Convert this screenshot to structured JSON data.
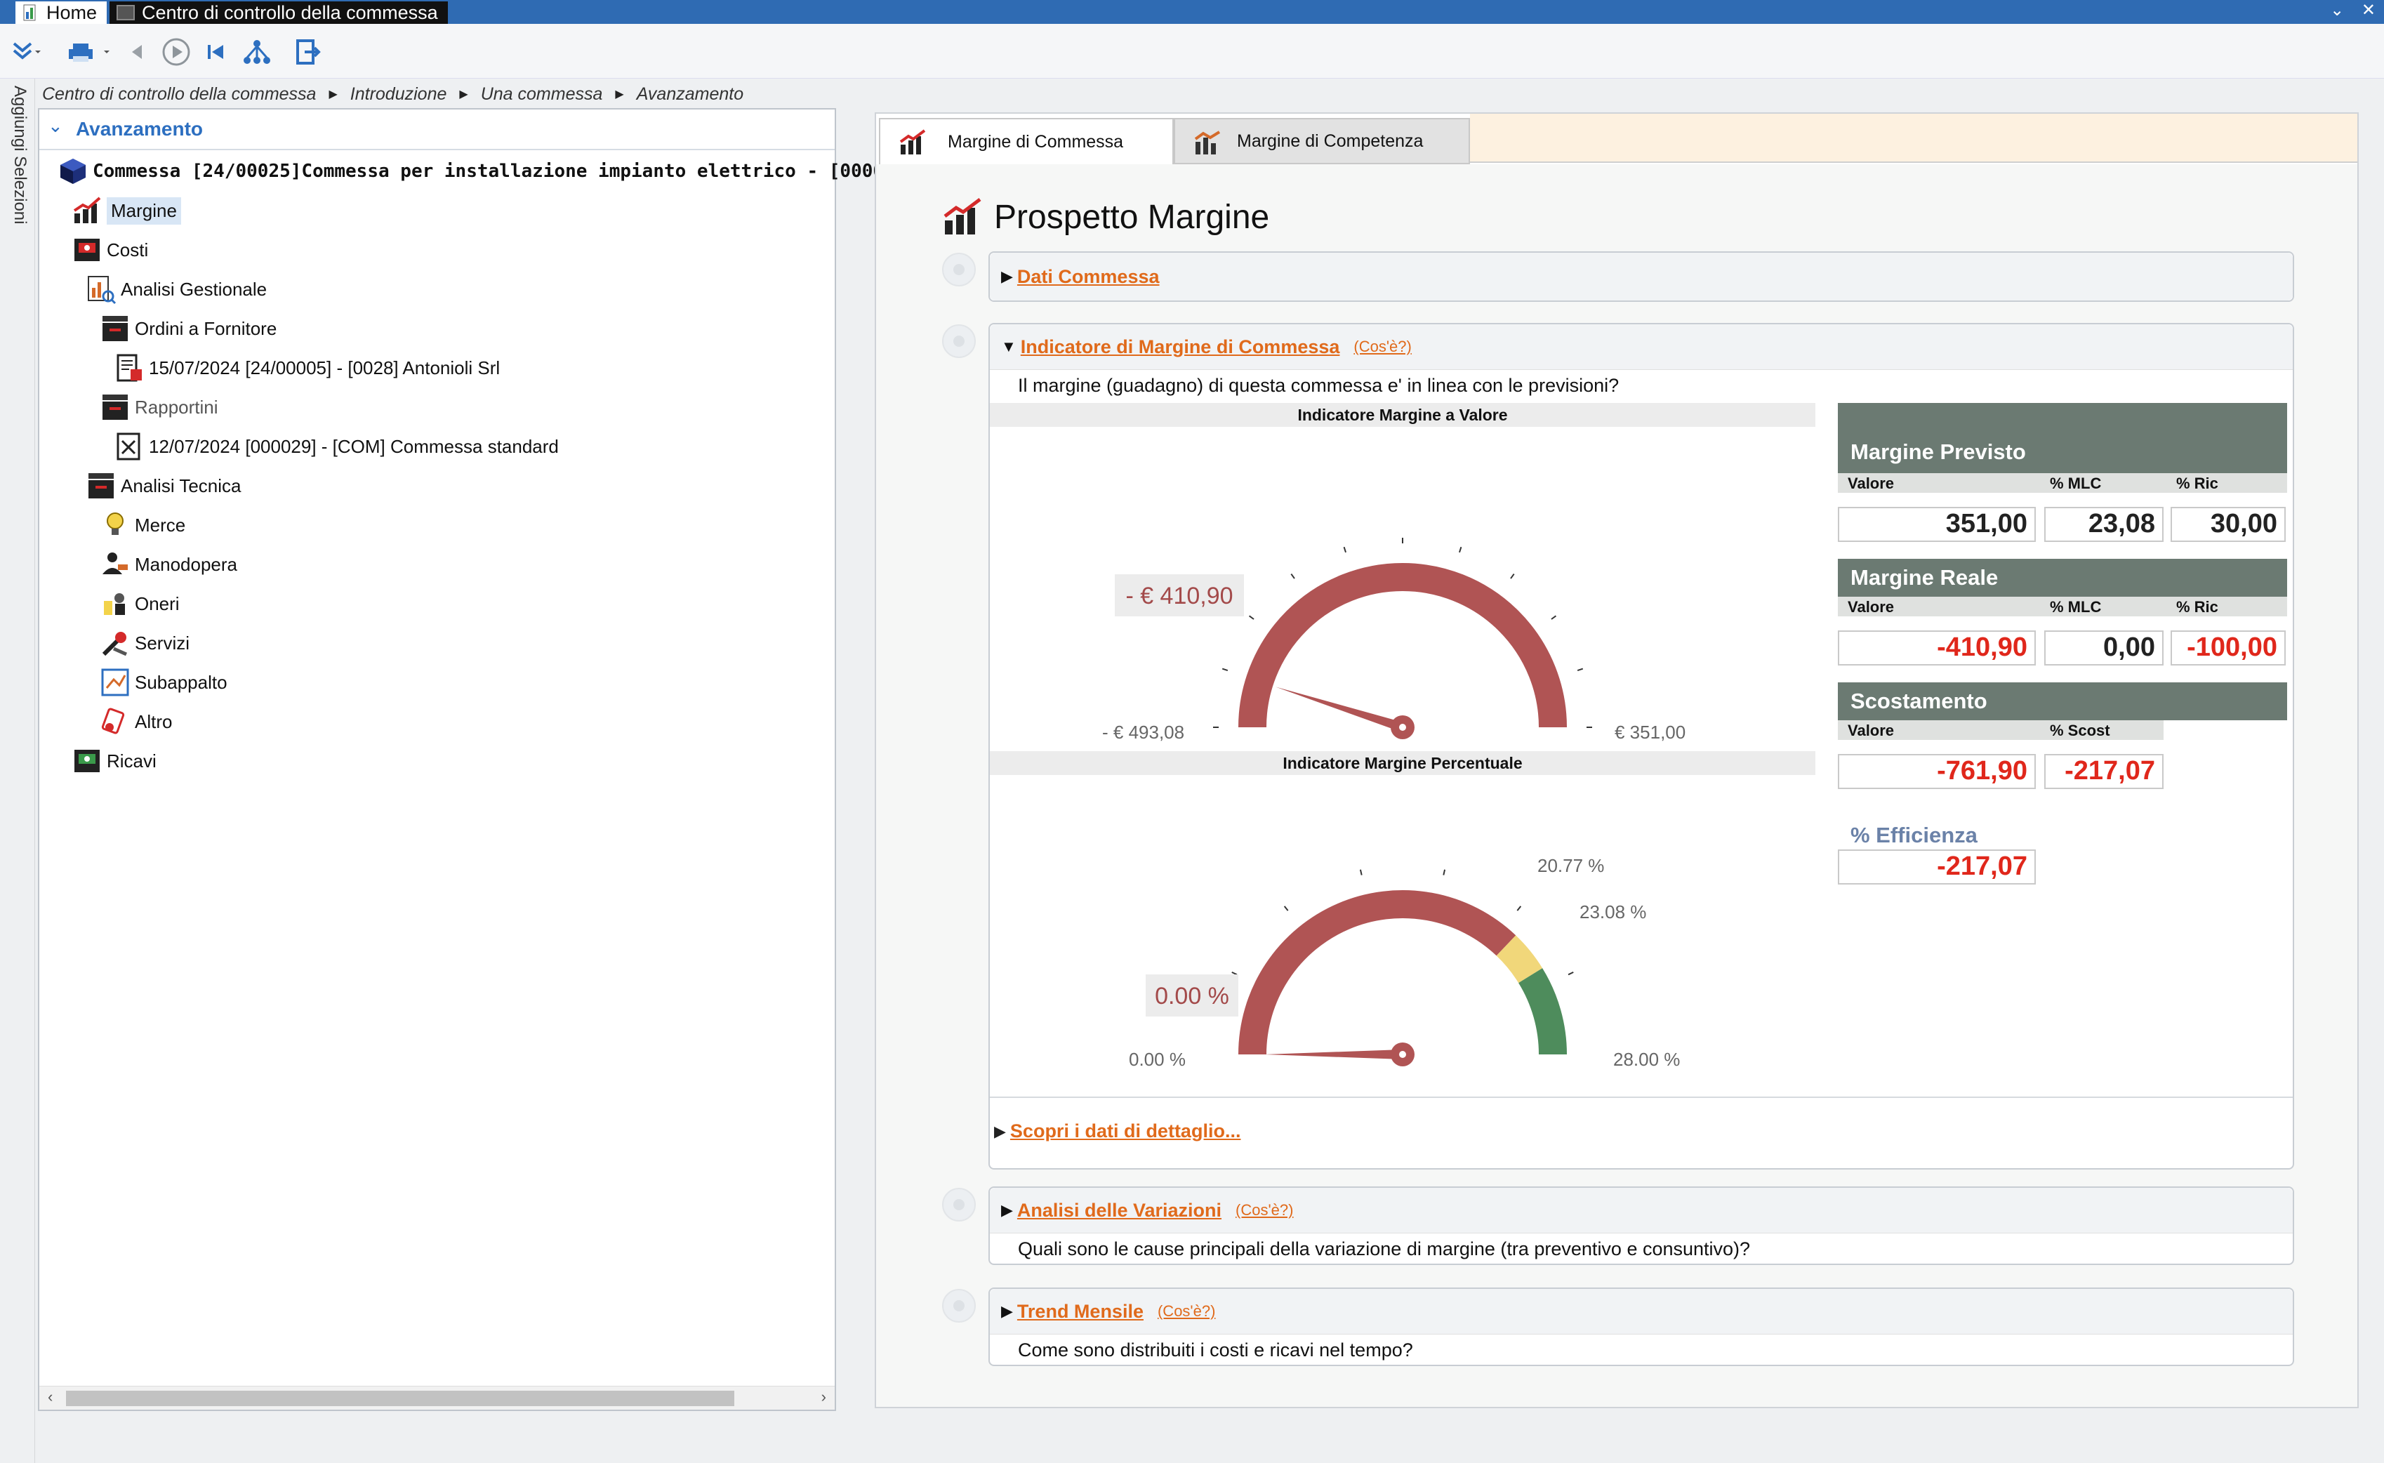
{
  "titlebar": {
    "home_tab": "Home",
    "active_tab": "Centro di controllo della commessa"
  },
  "breadcrumb": [
    "Centro di controllo della commessa",
    "Introduzione",
    "Una commessa",
    "Avanzamento"
  ],
  "side_strip": {
    "label": "Aggiungi Selezioni"
  },
  "left_panel": {
    "title": "Avanzamento",
    "tree": {
      "root": "Commessa [24/00025]Commessa per installazione impianto elettrico - [0000",
      "margine": "Margine",
      "costi": "Costi",
      "analisi_gestionale": "Analisi Gestionale",
      "ordini_fornitore": "Ordini a Fornitore",
      "ordine_item": "15/07/2024 [24/00005] - [0028] Antonioli Srl",
      "rapportini": "Rapportini",
      "rapportino_item": "12/07/2024 [000029] - [COM] Commessa standard",
      "analisi_tecnica": "Analisi Tecnica",
      "merce": "Merce",
      "manodopera": "Manodopera",
      "oneri": "Oneri",
      "servizi": "Servizi",
      "subappalto": "Subappalto",
      "altro": "Altro",
      "ricavi": "Ricavi"
    }
  },
  "right_panel": {
    "tabs": {
      "active": "Margine di Commessa",
      "inactive": "Margine di Competenza"
    },
    "page_title": "Prospetto Margine",
    "sections": {
      "dati": {
        "title": "Dati Commessa"
      },
      "indicatore": {
        "title": "Indicatore di Margine di Commessa",
        "cos": "(Cos'è?)",
        "question": "Il margine (guadagno) di questa commessa e' in linea con le previsioni?",
        "gauge_value": {
          "title": "Indicatore Margine a Valore",
          "current": "- € 410,90",
          "min": "- € 493,08",
          "max": "€ 351,00",
          "fraction": 0.098,
          "color": "#b05454"
        },
        "gauge_pct": {
          "title": "Indicatore Margine Percentuale",
          "current": "0.00 %",
          "min": "0.00 %",
          "band1": "20.77 %",
          "band2": "23.08 %",
          "max": "28.00 %",
          "fraction": 0.0,
          "band1_fraction": 0.742,
          "band2_fraction": 0.824,
          "colors": {
            "red": "#b05454",
            "yellow": "#f1d77a",
            "green": "#4e8c5c"
          }
        },
        "detail_link": "Scopri i dati di dettaglio..."
      },
      "variazioni": {
        "title": "Analisi delle Variazioni",
        "cos": "(Cos'è?)",
        "question": "Quali sono le cause principali della variazione di margine (tra preventivo e consuntivo)?"
      },
      "trend": {
        "title": "Trend Mensile",
        "cos": "(Cos'è?)",
        "question": "Come sono distribuiti i costi e ricavi nel tempo?"
      }
    },
    "metrics": {
      "previsto": {
        "title": "Margine Previsto",
        "col_valore": "Valore",
        "col_mlc": "% MLC",
        "col_ric": "% Ric",
        "valore": "351,00",
        "mlc": "23,08",
        "ric": "30,00"
      },
      "reale": {
        "title": "Margine Reale",
        "col_valore": "Valore",
        "col_mlc": "% MLC",
        "col_ric": "% Ric",
        "valore": "-410,90",
        "mlc": "0,00",
        "ric": "-100,00"
      },
      "scostamento": {
        "title": "Scostamento",
        "col_valore": "Valore",
        "col_scost": "% Scost",
        "valore": "-761,90",
        "scost": "-217,07"
      },
      "efficienza": {
        "title": "% Efficienza",
        "valore": "-217,07"
      }
    }
  }
}
